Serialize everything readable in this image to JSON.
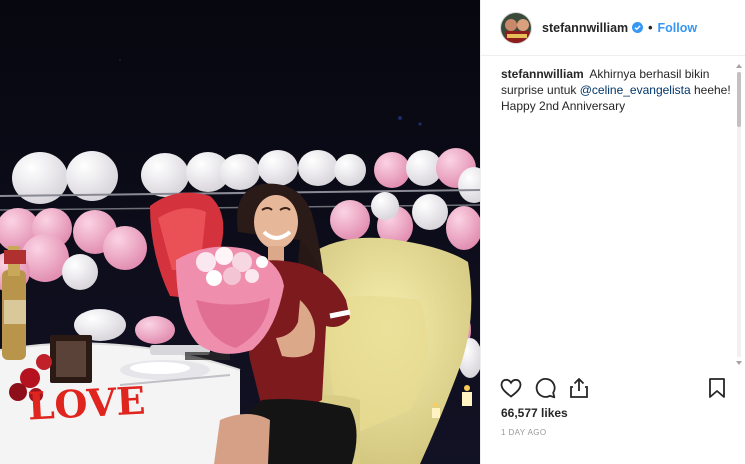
{
  "header": {
    "username": "stefannwilliam",
    "dot": "•",
    "follow_label": "Follow"
  },
  "caption": {
    "username": "stefannwilliam",
    "text_before": "Akhirnya berhasil bikin surprise untuk",
    "mention": "@celine_evangelista",
    "text_after": "heehe! Happy 2nd Anniversary"
  },
  "actions": {
    "like_icon": "heart-icon",
    "comment_icon": "comment-icon",
    "share_icon": "share-icon",
    "save_icon": "bookmark-icon"
  },
  "likes": "66,577 likes",
  "timestamp": "1 DAY AGO",
  "colors": {
    "link_blue": "#3897f0",
    "mention": "#003569",
    "verified": "#3897f0",
    "timestamp": "#999999"
  },
  "media": {
    "photo_overlay_text": "LOVE"
  }
}
